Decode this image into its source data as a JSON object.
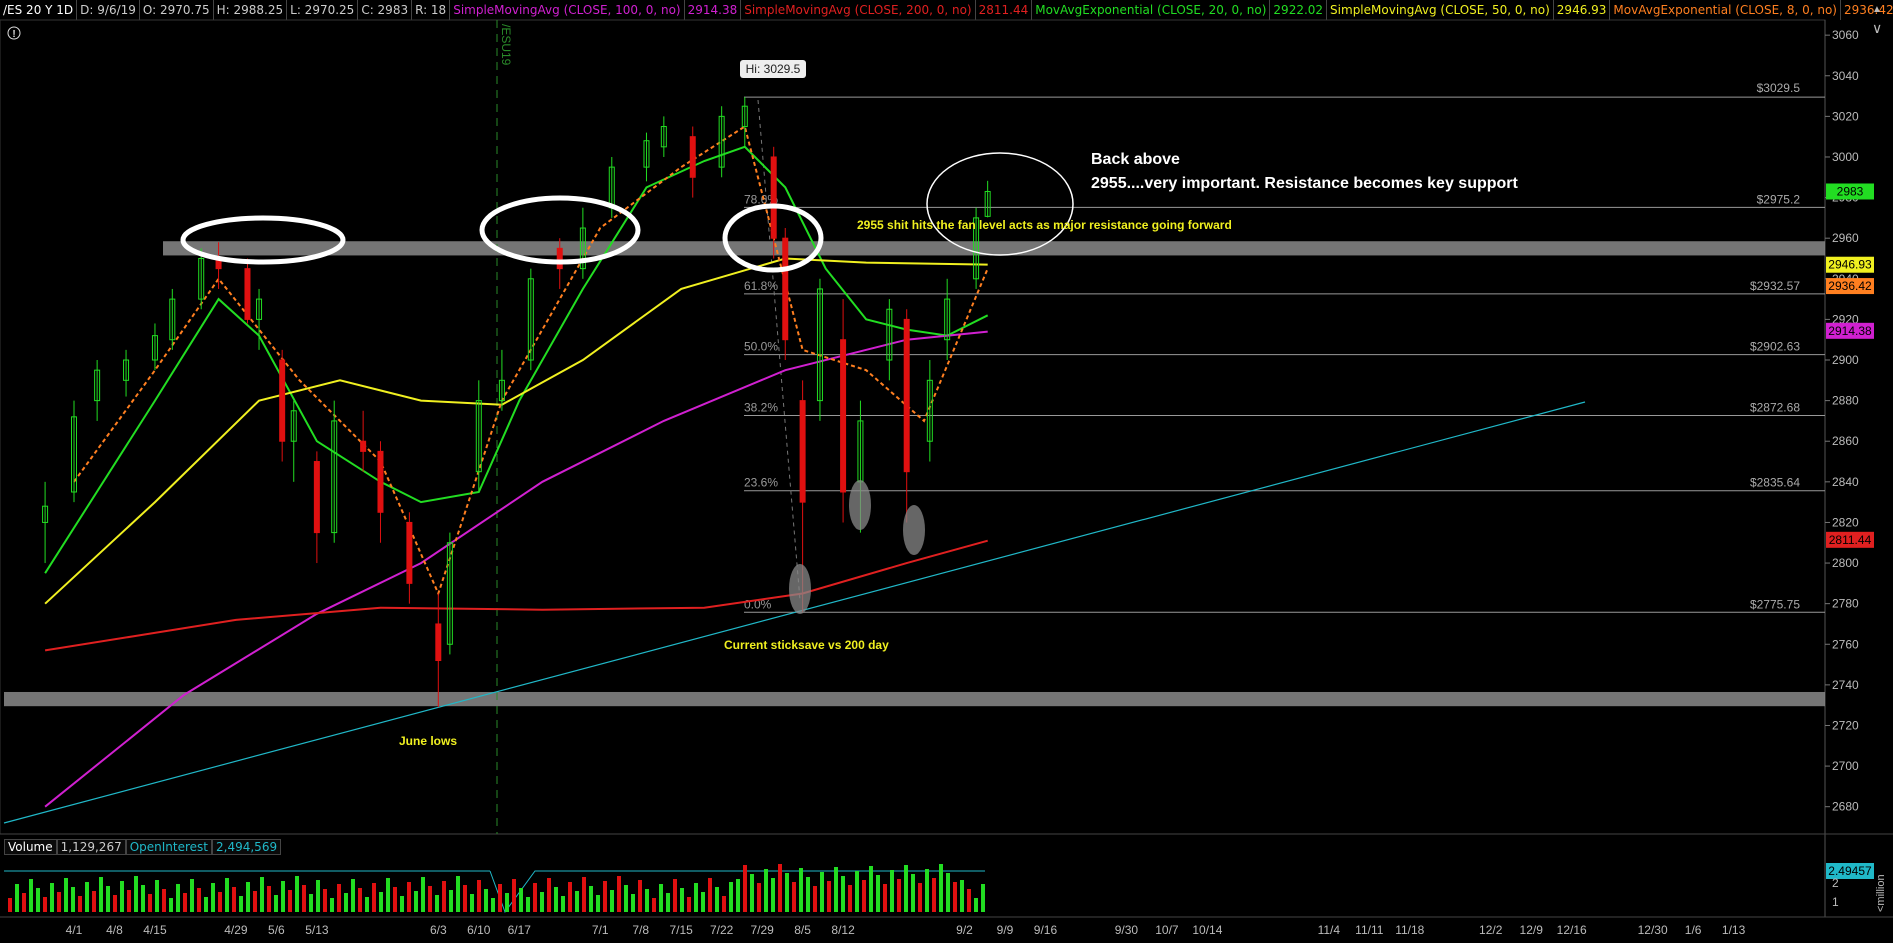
{
  "header": {
    "symbol": "/ES 20 Y 1D",
    "date": "D: 9/6/19",
    "open": "O: 2970.75",
    "high": "H: 2988.25",
    "low": "L: 2970.25",
    "close": "C: 2983",
    "range": "R: 18",
    "studies": [
      {
        "label": "SimpleMovingAvg (CLOSE, 100, 0, no)",
        "value": "2914.38",
        "color": "#d020d0"
      },
      {
        "label": "SimpleMovingAvg (CLOSE, 200, 0, no)",
        "value": "2811.44",
        "color": "#e02020"
      },
      {
        "label": "MovAvgExponential (CLOSE, 20, 0, no)",
        "value": "2922.02",
        "color": "#22dd22"
      },
      {
        "label": "SimpleMovingAvg (CLOSE, 50, 0, no)",
        "value": "2946.93",
        "color": "#f0f020"
      },
      {
        "label": "MovAvgExponential (CLOSE, 8, 0, no)",
        "value": "2936.42",
        "color": "#ff7f20"
      }
    ]
  },
  "colors": {
    "background": "#000000",
    "up": "#22dd22",
    "down": "#e01010",
    "sma100": "#d020d0",
    "sma200": "#e02020",
    "ema20": "#22dd22",
    "sma50": "#f0f020",
    "ema8": "#ff7f20",
    "trendline": "#20b8c8",
    "annotation": "#f0f020",
    "band": "#8a8a8a"
  },
  "chart_data": {
    "type": "candlestick",
    "title": "/ES 20 Y 1D",
    "ylim": [
      2670,
      3065
    ],
    "y_ticks": [
      2680,
      2700,
      2720,
      2740,
      2760,
      2780,
      2800,
      2820,
      2840,
      2860,
      2880,
      2900,
      2920,
      2940,
      2960,
      2980,
      3000,
      3020,
      3040,
      3060
    ],
    "x_ticks": [
      "4/1",
      "4/8",
      "4/15",
      "4/29",
      "5/6",
      "5/13",
      "6/3",
      "6/10",
      "6/17",
      "7/1",
      "7/8",
      "7/15",
      "7/22",
      "7/29",
      "8/5",
      "8/12",
      "9/2",
      "9/9",
      "9/16",
      "9/30",
      "10/7",
      "10/14",
      "11/4",
      "11/11",
      "11/18",
      "12/2",
      "12/9",
      "12/16",
      "12/30",
      "1/6",
      "1/13"
    ],
    "candles": [
      {
        "date": "3/27",
        "o": 2820,
        "h": 2840,
        "l": 2800,
        "c": 2828
      },
      {
        "date": "4/1",
        "o": 2835,
        "h": 2880,
        "l": 2830,
        "c": 2872
      },
      {
        "date": "4/5",
        "o": 2880,
        "h": 2900,
        "l": 2870,
        "c": 2895
      },
      {
        "date": "4/10",
        "o": 2890,
        "h": 2905,
        "l": 2882,
        "c": 2900
      },
      {
        "date": "4/15",
        "o": 2900,
        "h": 2918,
        "l": 2895,
        "c": 2912
      },
      {
        "date": "4/18",
        "o": 2910,
        "h": 2935,
        "l": 2905,
        "c": 2930
      },
      {
        "date": "4/23",
        "o": 2930,
        "h": 2955,
        "l": 2925,
        "c": 2950
      },
      {
        "date": "4/26",
        "o": 2950,
        "h": 2958,
        "l": 2935,
        "c": 2945
      },
      {
        "date": "5/1",
        "o": 2945,
        "h": 2950,
        "l": 2918,
        "c": 2920
      },
      {
        "date": "5/3",
        "o": 2920,
        "h": 2935,
        "l": 2905,
        "c": 2930
      },
      {
        "date": "5/7",
        "o": 2900,
        "h": 2905,
        "l": 2850,
        "c": 2860
      },
      {
        "date": "5/9",
        "o": 2860,
        "h": 2880,
        "l": 2840,
        "c": 2875
      },
      {
        "date": "5/13",
        "o": 2850,
        "h": 2855,
        "l": 2800,
        "c": 2815
      },
      {
        "date": "5/16",
        "o": 2815,
        "h": 2880,
        "l": 2810,
        "c": 2870
      },
      {
        "date": "5/21",
        "o": 2860,
        "h": 2875,
        "l": 2845,
        "c": 2855
      },
      {
        "date": "5/24",
        "o": 2855,
        "h": 2860,
        "l": 2810,
        "c": 2825
      },
      {
        "date": "5/29",
        "o": 2820,
        "h": 2825,
        "l": 2780,
        "c": 2790
      },
      {
        "date": "6/3",
        "o": 2770,
        "h": 2785,
        "l": 2729,
        "c": 2752
      },
      {
        "date": "6/5",
        "o": 2760,
        "h": 2815,
        "l": 2755,
        "c": 2810
      },
      {
        "date": "6/10",
        "o": 2845,
        "h": 2890,
        "l": 2835,
        "c": 2880
      },
      {
        "date": "6/14",
        "o": 2880,
        "h": 2905,
        "l": 2875,
        "c": 2890
      },
      {
        "date": "6/19",
        "o": 2900,
        "h": 2945,
        "l": 2895,
        "c": 2940
      },
      {
        "date": "6/24",
        "o": 2955,
        "h": 2960,
        "l": 2935,
        "c": 2945
      },
      {
        "date": "6/28",
        "o": 2945,
        "h": 2975,
        "l": 2940,
        "c": 2965
      },
      {
        "date": "7/3",
        "o": 2975,
        "h": 3000,
        "l": 2970,
        "c": 2995
      },
      {
        "date": "7/9",
        "o": 2995,
        "h": 3012,
        "l": 2988,
        "c": 3008
      },
      {
        "date": "7/12",
        "o": 3005,
        "h": 3020,
        "l": 3000,
        "c": 3015
      },
      {
        "date": "7/17",
        "o": 3010,
        "h": 3015,
        "l": 2980,
        "c": 2990
      },
      {
        "date": "7/22",
        "o": 2995,
        "h": 3025,
        "l": 2990,
        "c": 3020
      },
      {
        "date": "7/26",
        "o": 3015,
        "h": 3029.5,
        "l": 3005,
        "c": 3025
      },
      {
        "date": "7/31",
        "o": 3000,
        "h": 3005,
        "l": 2950,
        "c": 2960
      },
      {
        "date": "8/2",
        "o": 2960,
        "h": 2965,
        "l": 2900,
        "c": 2910
      },
      {
        "date": "8/5",
        "o": 2880,
        "h": 2890,
        "l": 2775.75,
        "c": 2830
      },
      {
        "date": "8/8",
        "o": 2880,
        "h": 2940,
        "l": 2870,
        "c": 2935
      },
      {
        "date": "8/12",
        "o": 2910,
        "h": 2930,
        "l": 2820,
        "c": 2835
      },
      {
        "date": "8/15",
        "o": 2840,
        "h": 2880,
        "l": 2815,
        "c": 2870
      },
      {
        "date": "8/20",
        "o": 2900,
        "h": 2930,
        "l": 2890,
        "c": 2925
      },
      {
        "date": "8/23",
        "o": 2920,
        "h": 2925,
        "l": 2820,
        "c": 2845
      },
      {
        "date": "8/27",
        "o": 2860,
        "h": 2900,
        "l": 2850,
        "c": 2890
      },
      {
        "date": "8/30",
        "o": 2910,
        "h": 2940,
        "l": 2900,
        "c": 2930
      },
      {
        "date": "9/4",
        "o": 2940,
        "h": 2975,
        "l": 2935,
        "c": 2970
      },
      {
        "date": "9/6",
        "o": 2970.75,
        "h": 2988.25,
        "l": 2970.25,
        "c": 2983
      }
    ],
    "price_badges": [
      {
        "value": "2983",
        "color": "#22dd22"
      },
      {
        "value": "2946.93",
        "color": "#f0f020"
      },
      {
        "value": "2936.42",
        "color": "#ff7f20"
      },
      {
        "value": "2914.38",
        "color": "#d020d0"
      },
      {
        "value": "2811.44",
        "color": "#e02020"
      }
    ],
    "fib_levels": [
      {
        "pct": "78.6%",
        "price": 2975.2,
        "label": "$2975.2"
      },
      {
        "pct": "61.8%",
        "price": 2932.57,
        "label": "$2932.57"
      },
      {
        "pct": "50.0%",
        "price": 2902.63,
        "label": "$2902.63"
      },
      {
        "pct": "38.2%",
        "price": 2872.68,
        "label": "$2872.68"
      },
      {
        "pct": "23.6%",
        "price": 2835.64,
        "label": "$2835.64"
      },
      {
        "pct": "0.0%",
        "price": 2775.75,
        "label": "$2775.75"
      }
    ],
    "high_level": {
      "price": 3029.5,
      "label": "$3029.5",
      "marker": "Hi: 3029.5"
    },
    "bands": [
      {
        "center": 2955,
        "half": 3.5
      },
      {
        "center": 2733,
        "half": 3.5
      }
    ],
    "contract_marker": "/ESU19",
    "annotations": {
      "back_above_1": "Back above",
      "back_above_2": "2955....very important. Resistance becomes key support",
      "fan_level": "2955 shit hits the fan level acts as  major resistance going forward",
      "stick_save": "Current sticksave vs 200 day",
      "june_lows": "June lows"
    },
    "volume_panel": {
      "volume_label": "Volume",
      "volume_value": "1,129,267",
      "oi_label": "OpenInterest",
      "oi_value": "2,494,569",
      "oi_badge": "2.49457",
      "axis_unit": "<million",
      "axis_ticks": [
        "2",
        "1"
      ]
    }
  }
}
